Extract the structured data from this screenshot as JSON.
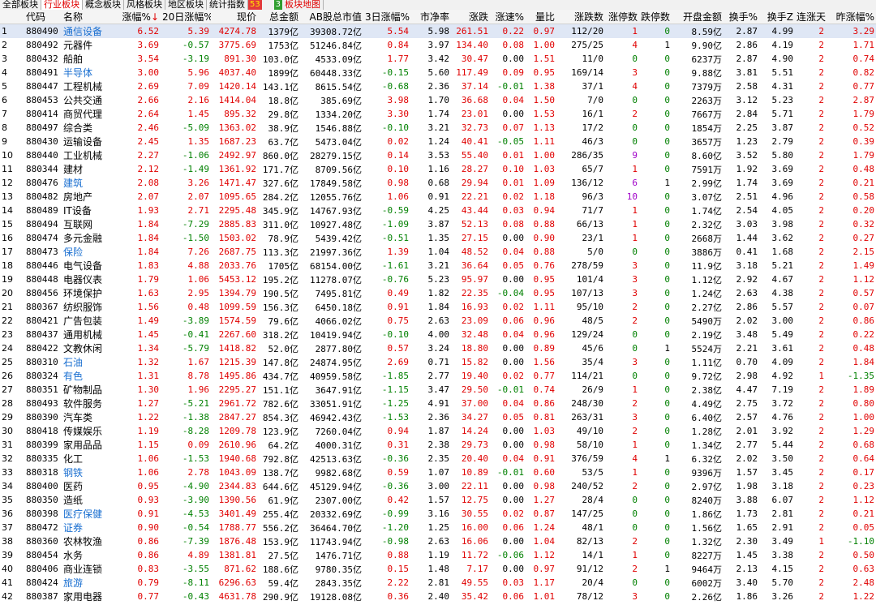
{
  "tabs": [
    {
      "label": "全部板块",
      "active": false
    },
    {
      "label": "行业板块",
      "active": true
    },
    {
      "label": "概念板块",
      "active": false
    },
    {
      "label": "风格板块",
      "active": false
    },
    {
      "label": "地区板块",
      "active": false
    },
    {
      "label": "统计指数",
      "active": false
    }
  ],
  "breadth": {
    "up": "53",
    "down": "3"
  },
  "map_tab": "板块地图",
  "columns": [
    "",
    "代码",
    "名称",
    "涨幅%",
    "20日涨幅%",
    "现价",
    "总金额",
    "AB股总市值",
    "3日涨幅%",
    "市净率",
    "涨跌",
    "涨速%",
    "量比",
    "涨跌数",
    "涨停数",
    "跌停数",
    "开盘金额",
    "换手%",
    "换手Z",
    "连涨天",
    "昨涨幅%"
  ],
  "sort_arrow": "↓",
  "colors": {
    "up": "#e00000",
    "down": "#008000",
    "highlight_name": "#1a6fd0",
    "purple": "#a000c8"
  },
  "rows": [
    {
      "i": "1",
      "code": "880490",
      "name": "通信设备",
      "hl": true,
      "v": [
        "6.52",
        "5.39",
        "4274.78",
        "1379亿",
        "39308.72亿",
        "5.54",
        "5.98",
        "261.51",
        "0.22",
        "0.97",
        "112/20",
        "1",
        "0",
        "8.59亿",
        "2.87",
        "4.99",
        "2",
        "3.29"
      ]
    },
    {
      "i": "2",
      "code": "880492",
      "name": "元器件",
      "hl": false,
      "v": [
        "3.69",
        "-0.57",
        "3775.69",
        "1753亿",
        "51246.84亿",
        "0.84",
        "3.97",
        "134.40",
        "0.08",
        "1.00",
        "275/25",
        "4",
        "1",
        "9.90亿",
        "2.86",
        "4.19",
        "2",
        "1.71"
      ]
    },
    {
      "i": "3",
      "code": "880432",
      "name": "船舶",
      "hl": false,
      "v": [
        "3.54",
        "-3.19",
        "891.30",
        "103.0亿",
        "4533.09亿",
        "1.77",
        "3.42",
        "30.47",
        "0.00",
        "1.51",
        "11/0",
        "0",
        "0",
        "6237万",
        "2.87",
        "4.90",
        "2",
        "0.74"
      ]
    },
    {
      "i": "4",
      "code": "880491",
      "name": "半导体",
      "hl": true,
      "v": [
        "3.00",
        "5.96",
        "4037.40",
        "1899亿",
        "60448.33亿",
        "-0.15",
        "5.60",
        "117.49",
        "0.09",
        "0.95",
        "169/14",
        "3",
        "0",
        "9.88亿",
        "3.81",
        "5.51",
        "2",
        "0.82"
      ]
    },
    {
      "i": "5",
      "code": "880447",
      "name": "工程机械",
      "hl": false,
      "v": [
        "2.69",
        "7.09",
        "1420.14",
        "143.1亿",
        "8615.54亿",
        "-0.68",
        "2.36",
        "37.14",
        "-0.01",
        "1.38",
        "37/1",
        "4",
        "0",
        "7379万",
        "2.58",
        "4.31",
        "2",
        "0.77"
      ]
    },
    {
      "i": "6",
      "code": "880453",
      "name": "公共交通",
      "hl": false,
      "v": [
        "2.66",
        "2.16",
        "1414.04",
        "18.8亿",
        "385.69亿",
        "3.98",
        "1.70",
        "36.68",
        "0.04",
        "1.50",
        "7/0",
        "0",
        "0",
        "2263万",
        "3.12",
        "5.23",
        "2",
        "2.87"
      ]
    },
    {
      "i": "7",
      "code": "880414",
      "name": "商贸代理",
      "hl": false,
      "v": [
        "2.64",
        "1.45",
        "895.32",
        "29.8亿",
        "1334.20亿",
        "3.30",
        "1.74",
        "23.01",
        "0.00",
        "1.53",
        "16/1",
        "2",
        "0",
        "7667万",
        "2.84",
        "5.71",
        "2",
        "1.79"
      ]
    },
    {
      "i": "8",
      "code": "880497",
      "name": "综合类",
      "hl": false,
      "v": [
        "2.46",
        "-5.09",
        "1363.02",
        "38.9亿",
        "1546.88亿",
        "-0.10",
        "3.21",
        "32.73",
        "0.07",
        "1.13",
        "17/2",
        "0",
        "0",
        "1854万",
        "2.25",
        "3.87",
        "2",
        "0.52"
      ]
    },
    {
      "i": "9",
      "code": "880430",
      "name": "运输设备",
      "hl": false,
      "v": [
        "2.45",
        "1.35",
        "1687.23",
        "63.7亿",
        "5473.04亿",
        "0.02",
        "1.24",
        "40.41",
        "-0.05",
        "1.11",
        "46/3",
        "0",
        "0",
        "3657万",
        "1.23",
        "2.79",
        "2",
        "0.39"
      ]
    },
    {
      "i": "10",
      "code": "880440",
      "name": "工业机械",
      "hl": false,
      "v": [
        "2.27",
        "-1.06",
        "2492.97",
        "860.0亿",
        "28279.15亿",
        "0.14",
        "3.53",
        "55.40",
        "0.01",
        "1.00",
        "286/35",
        "9",
        "0",
        "8.60亿",
        "3.52",
        "5.80",
        "2",
        "1.79"
      ]
    },
    {
      "i": "11",
      "code": "880344",
      "name": "建材",
      "hl": false,
      "v": [
        "2.12",
        "-1.49",
        "1361.92",
        "171.7亿",
        "8709.56亿",
        "0.10",
        "1.16",
        "28.27",
        "0.10",
        "1.03",
        "65/7",
        "1",
        "0",
        "7591万",
        "1.92",
        "3.69",
        "2",
        "0.48"
      ]
    },
    {
      "i": "12",
      "code": "880476",
      "name": "建筑",
      "hl": true,
      "v": [
        "2.08",
        "3.26",
        "1471.47",
        "327.6亿",
        "17849.58亿",
        "0.98",
        "0.68",
        "29.94",
        "0.01",
        "1.09",
        "136/12",
        "6",
        "1",
        "2.99亿",
        "1.74",
        "3.69",
        "2",
        "0.21"
      ]
    },
    {
      "i": "13",
      "code": "880482",
      "name": "房地产",
      "hl": false,
      "v": [
        "2.07",
        "2.07",
        "1095.65",
        "284.2亿",
        "12055.76亿",
        "1.06",
        "0.91",
        "22.21",
        "0.02",
        "1.18",
        "96/3",
        "10",
        "0",
        "3.07亿",
        "2.51",
        "4.96",
        "2",
        "0.58"
      ]
    },
    {
      "i": "14",
      "code": "880489",
      "name": "IT设备",
      "hl": false,
      "v": [
        "1.93",
        "2.71",
        "2295.48",
        "345.9亿",
        "14767.93亿",
        "-0.59",
        "4.25",
        "43.44",
        "0.03",
        "0.94",
        "71/7",
        "1",
        "0",
        "1.74亿",
        "2.54",
        "4.05",
        "2",
        "0.20"
      ]
    },
    {
      "i": "15",
      "code": "880494",
      "name": "互联网",
      "hl": false,
      "v": [
        "1.84",
        "-7.29",
        "2885.83",
        "311.0亿",
        "10927.48亿",
        "-1.09",
        "3.87",
        "52.13",
        "0.08",
        "0.88",
        "66/13",
        "1",
        "0",
        "2.32亿",
        "3.03",
        "3.98",
        "2",
        "0.32"
      ]
    },
    {
      "i": "16",
      "code": "880474",
      "name": "多元金融",
      "hl": false,
      "v": [
        "1.84",
        "-1.50",
        "1503.02",
        "78.9亿",
        "5439.42亿",
        "-0.51",
        "1.35",
        "27.15",
        "0.00",
        "0.90",
        "23/1",
        "1",
        "0",
        "2668万",
        "1.44",
        "3.62",
        "2",
        "0.27"
      ]
    },
    {
      "i": "17",
      "code": "880473",
      "name": "保险",
      "hl": true,
      "v": [
        "1.84",
        "7.26",
        "2687.75",
        "113.3亿",
        "21997.36亿",
        "1.39",
        "1.04",
        "48.52",
        "0.04",
        "0.88",
        "5/0",
        "0",
        "0",
        "3886万",
        "0.41",
        "1.68",
        "2",
        "2.15"
      ]
    },
    {
      "i": "18",
      "code": "880446",
      "name": "电气设备",
      "hl": false,
      "v": [
        "1.83",
        "4.88",
        "2033.76",
        "1705亿",
        "68154.00亿",
        "-1.61",
        "3.21",
        "36.64",
        "0.05",
        "0.76",
        "278/59",
        "3",
        "0",
        "11.9亿",
        "3.18",
        "5.21",
        "2",
        "1.49"
      ]
    },
    {
      "i": "19",
      "code": "880448",
      "name": "电器仪表",
      "hl": false,
      "v": [
        "1.79",
        "1.06",
        "5453.12",
        "195.2亿",
        "11278.07亿",
        "-0.76",
        "5.23",
        "95.97",
        "0.00",
        "0.95",
        "101/4",
        "3",
        "0",
        "1.12亿",
        "2.92",
        "4.67",
        "2",
        "1.12"
      ]
    },
    {
      "i": "20",
      "code": "880456",
      "name": "环境保护",
      "hl": false,
      "v": [
        "1.63",
        "2.95",
        "1394.79",
        "190.5亿",
        "7495.81亿",
        "0.49",
        "1.82",
        "22.35",
        "-0.04",
        "0.95",
        "107/13",
        "3",
        "0",
        "1.24亿",
        "2.63",
        "4.38",
        "2",
        "0.57"
      ]
    },
    {
      "i": "21",
      "code": "880367",
      "name": "纺织服饰",
      "hl": false,
      "v": [
        "1.56",
        "0.48",
        "1099.59",
        "156.3亿",
        "6450.18亿",
        "0.91",
        "1.84",
        "16.93",
        "0.02",
        "1.11",
        "95/10",
        "2",
        "0",
        "2.27亿",
        "2.86",
        "5.57",
        "2",
        "0.07"
      ]
    },
    {
      "i": "22",
      "code": "880421",
      "name": "广告包装",
      "hl": false,
      "v": [
        "1.49",
        "-3.89",
        "1574.59",
        "79.6亿",
        "4066.02亿",
        "0.75",
        "2.63",
        "23.09",
        "0.06",
        "0.96",
        "48/5",
        "2",
        "0",
        "5490万",
        "2.02",
        "3.00",
        "2",
        "0.86"
      ]
    },
    {
      "i": "23",
      "code": "880437",
      "name": "通用机械",
      "hl": false,
      "v": [
        "1.45",
        "-0.41",
        "2267.60",
        "318.2亿",
        "10419.94亿",
        "-0.10",
        "4.00",
        "32.48",
        "0.04",
        "0.96",
        "129/24",
        "0",
        "0",
        "2.19亿",
        "3.48",
        "5.49",
        "2",
        "0.22"
      ]
    },
    {
      "i": "24",
      "code": "880422",
      "name": "文教休闲",
      "hl": false,
      "v": [
        "1.34",
        "-5.79",
        "1418.82",
        "52.0亿",
        "2877.80亿",
        "0.57",
        "3.24",
        "18.80",
        "0.00",
        "0.89",
        "45/6",
        "0",
        "1",
        "5524万",
        "2.21",
        "3.61",
        "2",
        "0.48"
      ]
    },
    {
      "i": "25",
      "code": "880310",
      "name": "石油",
      "hl": true,
      "v": [
        "1.32",
        "1.67",
        "1215.39",
        "147.8亿",
        "24874.95亿",
        "2.69",
        "0.71",
        "15.82",
        "0.00",
        "1.56",
        "35/4",
        "3",
        "0",
        "1.11亿",
        "0.70",
        "4.09",
        "2",
        "1.84"
      ]
    },
    {
      "i": "26",
      "code": "880324",
      "name": "有色",
      "hl": true,
      "v": [
        "1.31",
        "8.78",
        "1495.86",
        "434.7亿",
        "40959.58亿",
        "-1.85",
        "2.77",
        "19.40",
        "0.02",
        "0.77",
        "114/21",
        "0",
        "0",
        "9.72亿",
        "2.98",
        "4.92",
        "1",
        "-1.35"
      ]
    },
    {
      "i": "27",
      "code": "880351",
      "name": "矿物制品",
      "hl": false,
      "v": [
        "1.30",
        "1.96",
        "2295.27",
        "151.1亿",
        "3647.91亿",
        "-1.15",
        "3.47",
        "29.50",
        "-0.01",
        "0.74",
        "26/9",
        "1",
        "0",
        "2.38亿",
        "4.47",
        "7.19",
        "2",
        "1.89"
      ]
    },
    {
      "i": "28",
      "code": "880493",
      "name": "软件服务",
      "hl": false,
      "v": [
        "1.27",
        "-5.21",
        "2961.72",
        "782.6亿",
        "33051.91亿",
        "-1.25",
        "4.91",
        "37.00",
        "0.04",
        "0.86",
        "248/30",
        "2",
        "0",
        "4.49亿",
        "2.75",
        "3.72",
        "2",
        "0.80"
      ]
    },
    {
      "i": "29",
      "code": "880390",
      "name": "汽车类",
      "hl": false,
      "v": [
        "1.22",
        "-1.38",
        "2847.27",
        "854.3亿",
        "46942.43亿",
        "-1.53",
        "2.36",
        "34.27",
        "0.05",
        "0.81",
        "263/31",
        "3",
        "0",
        "6.40亿",
        "2.57",
        "4.76",
        "2",
        "1.00"
      ]
    },
    {
      "i": "30",
      "code": "880418",
      "name": "传媒娱乐",
      "hl": false,
      "v": [
        "1.19",
        "-8.28",
        "1209.78",
        "123.9亿",
        "7260.04亿",
        "0.94",
        "1.87",
        "14.24",
        "0.00",
        "1.03",
        "49/10",
        "2",
        "0",
        "1.28亿",
        "2.01",
        "3.92",
        "2",
        "1.29"
      ]
    },
    {
      "i": "31",
      "code": "880399",
      "name": "家用品品",
      "hl": false,
      "v": [
        "1.15",
        "0.09",
        "2610.96",
        "64.2亿",
        "4000.31亿",
        "0.31",
        "2.38",
        "29.73",
        "0.00",
        "0.98",
        "58/10",
        "1",
        "0",
        "1.34亿",
        "2.77",
        "5.44",
        "2",
        "0.68"
      ]
    },
    {
      "i": "32",
      "code": "880335",
      "name": "化工",
      "hl": false,
      "v": [
        "1.06",
        "-1.53",
        "1940.68",
        "792.8亿",
        "42513.63亿",
        "-0.36",
        "2.35",
        "20.40",
        "0.04",
        "0.91",
        "376/59",
        "4",
        "1",
        "6.32亿",
        "2.02",
        "3.50",
        "2",
        "0.64"
      ]
    },
    {
      "i": "33",
      "code": "880318",
      "name": "钢铁",
      "hl": true,
      "v": [
        "1.06",
        "2.78",
        "1043.09",
        "138.7亿",
        "9982.68亿",
        "0.59",
        "1.07",
        "10.89",
        "-0.01",
        "0.60",
        "53/5",
        "1",
        "0",
        "9396万",
        "1.57",
        "3.45",
        "2",
        "0.17"
      ]
    },
    {
      "i": "34",
      "code": "880400",
      "name": "医药",
      "hl": false,
      "v": [
        "0.95",
        "-4.90",
        "2344.83",
        "644.6亿",
        "45129.94亿",
        "-0.36",
        "3.00",
        "22.11",
        "0.00",
        "0.98",
        "240/52",
        "2",
        "0",
        "2.97亿",
        "1.98",
        "3.18",
        "2",
        "0.23"
      ]
    },
    {
      "i": "35",
      "code": "880350",
      "name": "造纸",
      "hl": false,
      "v": [
        "0.93",
        "-3.90",
        "1390.56",
        "61.9亿",
        "2307.00亿",
        "0.42",
        "1.57",
        "12.75",
        "0.00",
        "1.27",
        "28/4",
        "0",
        "0",
        "8240万",
        "3.88",
        "6.07",
        "2",
        "1.12"
      ]
    },
    {
      "i": "36",
      "code": "880398",
      "name": "医疗保健",
      "hl": true,
      "v": [
        "0.91",
        "-4.53",
        "3401.49",
        "255.4亿",
        "20332.69亿",
        "-0.99",
        "3.16",
        "30.55",
        "0.02",
        "0.87",
        "147/25",
        "0",
        "0",
        "1.86亿",
        "1.73",
        "2.81",
        "2",
        "0.21"
      ]
    },
    {
      "i": "37",
      "code": "880472",
      "name": "证券",
      "hl": true,
      "v": [
        "0.90",
        "-0.54",
        "1788.77",
        "556.2亿",
        "36464.70亿",
        "-1.20",
        "1.25",
        "16.00",
        "0.06",
        "1.24",
        "48/1",
        "0",
        "0",
        "1.56亿",
        "1.65",
        "2.91",
        "2",
        "0.05"
      ]
    },
    {
      "i": "38",
      "code": "880360",
      "name": "农林牧渔",
      "hl": false,
      "v": [
        "0.86",
        "-7.39",
        "1876.48",
        "153.9亿",
        "11743.94亿",
        "-0.98",
        "2.63",
        "16.06",
        "0.00",
        "1.04",
        "82/13",
        "2",
        "0",
        "1.32亿",
        "2.30",
        "3.49",
        "1",
        "-1.10"
      ]
    },
    {
      "i": "39",
      "code": "880454",
      "name": "水务",
      "hl": false,
      "v": [
        "0.86",
        "4.89",
        "1381.81",
        "27.5亿",
        "1476.71亿",
        "0.88",
        "1.19",
        "11.72",
        "-0.06",
        "1.12",
        "14/1",
        "1",
        "0",
        "8227万",
        "1.45",
        "3.38",
        "2",
        "0.50"
      ]
    },
    {
      "i": "40",
      "code": "880406",
      "name": "商业连锁",
      "hl": false,
      "v": [
        "0.83",
        "-3.55",
        "871.62",
        "188.6亿",
        "9780.35亿",
        "0.15",
        "1.48",
        "7.17",
        "0.00",
        "0.97",
        "91/12",
        "2",
        "1",
        "9464万",
        "2.13",
        "4.15",
        "2",
        "0.63"
      ]
    },
    {
      "i": "41",
      "code": "880424",
      "name": "旅游",
      "hl": true,
      "v": [
        "0.79",
        "-8.11",
        "6296.63",
        "59.4亿",
        "2843.35亿",
        "2.22",
        "2.81",
        "49.55",
        "0.03",
        "1.17",
        "20/4",
        "0",
        "0",
        "6002万",
        "3.40",
        "5.70",
        "2",
        "2.48"
      ]
    },
    {
      "i": "42",
      "code": "880387",
      "name": "家用电器",
      "hl": false,
      "v": [
        "0.77",
        "-0.43",
        "4631.78",
        "290.9亿",
        "19128.08亿",
        "0.36",
        "2.40",
        "35.42",
        "0.06",
        "1.01",
        "78/12",
        "3",
        "0",
        "2.26亿",
        "1.86",
        "3.26",
        "2",
        "1.22"
      ]
    }
  ]
}
